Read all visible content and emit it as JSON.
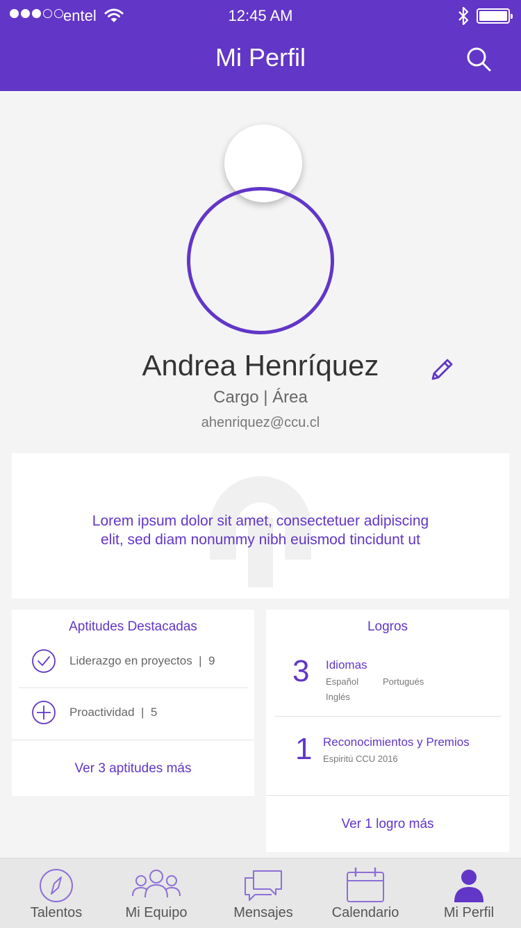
{
  "status_bar": {
    "carrier": "entel",
    "time": "12:45 AM",
    "signal_bars_filled": 3,
    "signal_bars_total": 5,
    "battery_level": 1.0
  },
  "header": {
    "title": "Mi Perfil",
    "search_icon": "search-icon"
  },
  "profile": {
    "name": "Andrea Henríquez",
    "role": "Cargo | Área",
    "email": "ahenriquez@ccu.cl",
    "edit_icon": "pencil-icon"
  },
  "about": {
    "line1": "Lorem ipsum dolor sit amet, consectetuer adipiscing",
    "line2": "elit, sed diam nonummy nibh euismod tincidunt ut"
  },
  "skills": {
    "title": "Aptitudes Destacadas",
    "items": [
      {
        "label": "Liderazgo en proyectos  |  9",
        "icon": "check-circle-icon"
      },
      {
        "label": "Proactividad  |  5",
        "icon": "plus-circle-icon"
      }
    ],
    "more_link": "Ver 3 aptitudes más"
  },
  "achievements": {
    "title": "Logros",
    "items": [
      {
        "count": "3",
        "title": "Idiomas",
        "details": [
          "Español",
          "Portugués",
          "Inglés"
        ]
      },
      {
        "count": "1",
        "title": "Reconocimientos y Premios",
        "details": [
          "Espiritú CCU 2016"
        ]
      }
    ],
    "more_link": "Ver 1 logro más"
  },
  "tabbar": {
    "tabs": [
      {
        "label": "Talentos",
        "icon": "compass-icon",
        "active": false
      },
      {
        "label": "Mi Equipo",
        "icon": "team-icon",
        "active": false
      },
      {
        "label": "Mensajes",
        "icon": "chat-icon",
        "active": false
      },
      {
        "label": "Calendario",
        "icon": "calendar-icon",
        "active": false
      },
      {
        "label": "Mi Perfil",
        "icon": "user-icon",
        "active": true
      }
    ]
  },
  "colors": {
    "accent": "#6236c7",
    "background": "#f4f4f4",
    "tabbar": "#e7e7e7"
  }
}
